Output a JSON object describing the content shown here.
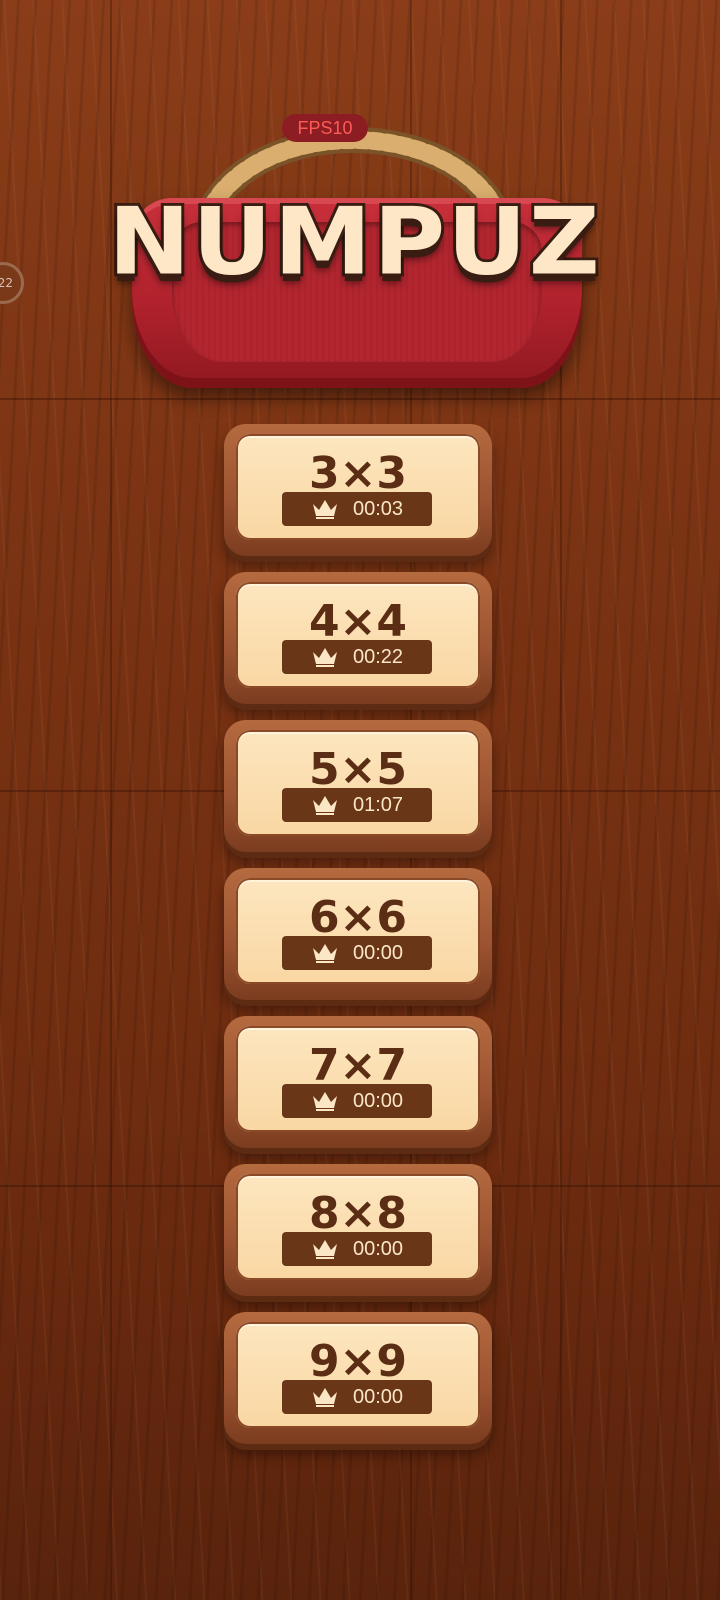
{
  "overlay": {
    "fps": "FPS10",
    "side_bubble": "22"
  },
  "title": {
    "logo": "NUMPUZ"
  },
  "levels": [
    {
      "size": "3×3",
      "best_time": "00:03"
    },
    {
      "size": "4×4",
      "best_time": "00:22"
    },
    {
      "size": "5×5",
      "best_time": "01:07"
    },
    {
      "size": "6×6",
      "best_time": "00:00"
    },
    {
      "size": "7×7",
      "best_time": "00:00"
    },
    {
      "size": "8×8",
      "best_time": "00:00"
    },
    {
      "size": "9×9",
      "best_time": "00:00"
    }
  ],
  "colors": {
    "wood": "#7a3313",
    "sign_red": "#b0222d",
    "button_face": "#f9d7a3",
    "button_text": "#5a2d14",
    "time_bar": "#6a3618",
    "time_text": "#fbe6c5"
  },
  "icons": {
    "record": "crown-icon"
  }
}
